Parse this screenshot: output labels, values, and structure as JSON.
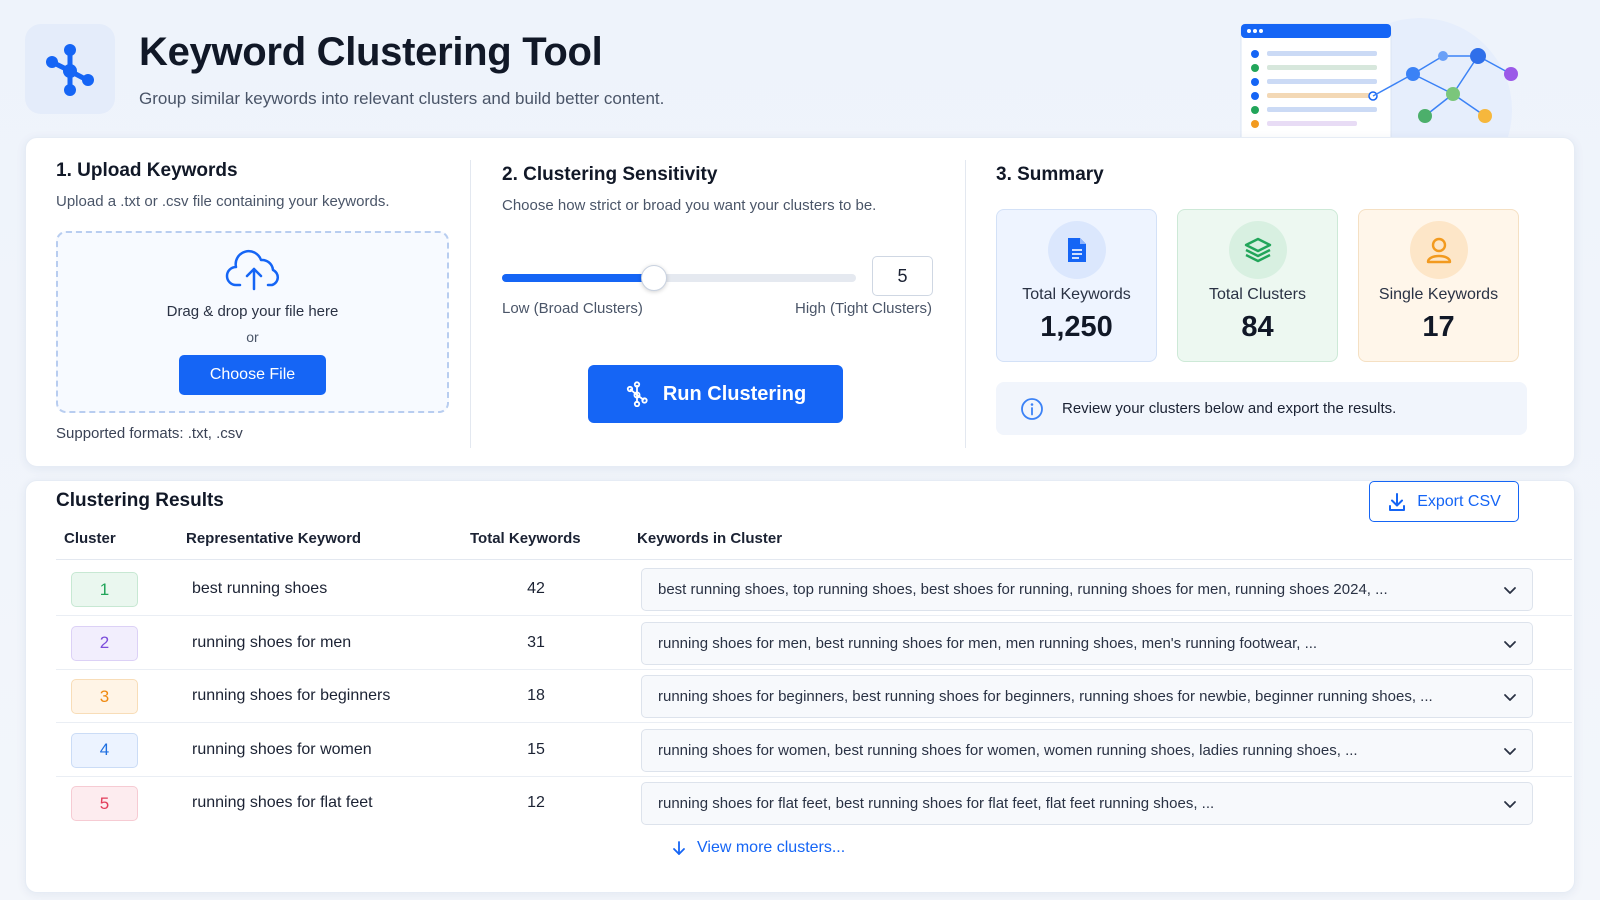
{
  "header": {
    "title": "Keyword Clustering Tool",
    "subtitle": "Group similar keywords into relevant clusters and build better content."
  },
  "upload": {
    "title": "1. Upload Keywords",
    "description": "Upload a .txt or .csv file containing your keywords.",
    "drop_text": "Drag & drop your file here",
    "or_text": "or",
    "button_label": "Choose File",
    "formats": "Supported formats: .txt, .csv"
  },
  "sensitivity": {
    "title": "2. Clustering Sensitivity",
    "description": "Choose how strict or broad you want your clusters to be.",
    "value": "5",
    "level_fraction": 0.43,
    "low_label": "Low (Broad Clusters)",
    "high_label": "High (Tight Clusters)",
    "run_label": "Run Clustering"
  },
  "summary": {
    "title": "3. Summary",
    "stats": [
      {
        "label": "Total Keywords",
        "value": "1,250",
        "icon": "document-icon",
        "color": "#1565f5"
      },
      {
        "label": "Total Clusters",
        "value": "84",
        "icon": "layers-icon",
        "color": "#22a55a"
      },
      {
        "label": "Single Keywords",
        "value": "17",
        "icon": "user-icon",
        "color": "#f29a1f"
      }
    ],
    "info": "Review your clusters below and export the results."
  },
  "results": {
    "title": "Clustering Results",
    "export_label": "Export CSV",
    "columns": [
      "Cluster",
      "Representative Keyword",
      "Total Keywords",
      "Keywords in Cluster"
    ],
    "rows": [
      {
        "cluster": "1",
        "representative": "best running shoes",
        "total": "42",
        "keywords": "best running shoes, top running shoes, best shoes for running, running shoes for men, running shoes 2024, ...",
        "color": "#22a55a",
        "bg": "#eaf7ef",
        "border": "#c7e8d3"
      },
      {
        "cluster": "2",
        "representative": "running shoes for men",
        "total": "31",
        "keywords": "running shoes for men, best running shoes for men, men running shoes, men's running footwear, ...",
        "color": "#7c4ddb",
        "bg": "#f2eefd",
        "border": "#dcd1f6"
      },
      {
        "cluster": "3",
        "representative": "running shoes for beginners",
        "total": "18",
        "keywords": "running shoes for beginners, best running shoes for beginners, running shoes for newbie, beginner running shoes, ...",
        "color": "#ef8a12",
        "bg": "#fff4e6",
        "border": "#f8ddb8"
      },
      {
        "cluster": "4",
        "representative": "running shoes for women",
        "total": "15",
        "keywords": "running shoes for women, best running shoes for women, women running shoes, ladies running shoes, ...",
        "color": "#1f6fe0",
        "bg": "#ecf3ff",
        "border": "#cbdcf6"
      },
      {
        "cluster": "5",
        "representative": "running shoes for flat feet",
        "total": "12",
        "keywords": "running shoes for flat feet, best running shoes for flat feet, flat feet running shoes, ...",
        "color": "#e23c5a",
        "bg": "#fdecef",
        "border": "#f6cbd3"
      }
    ],
    "view_more": "View more clusters..."
  },
  "colors": {
    "accent": "#1565f5"
  }
}
